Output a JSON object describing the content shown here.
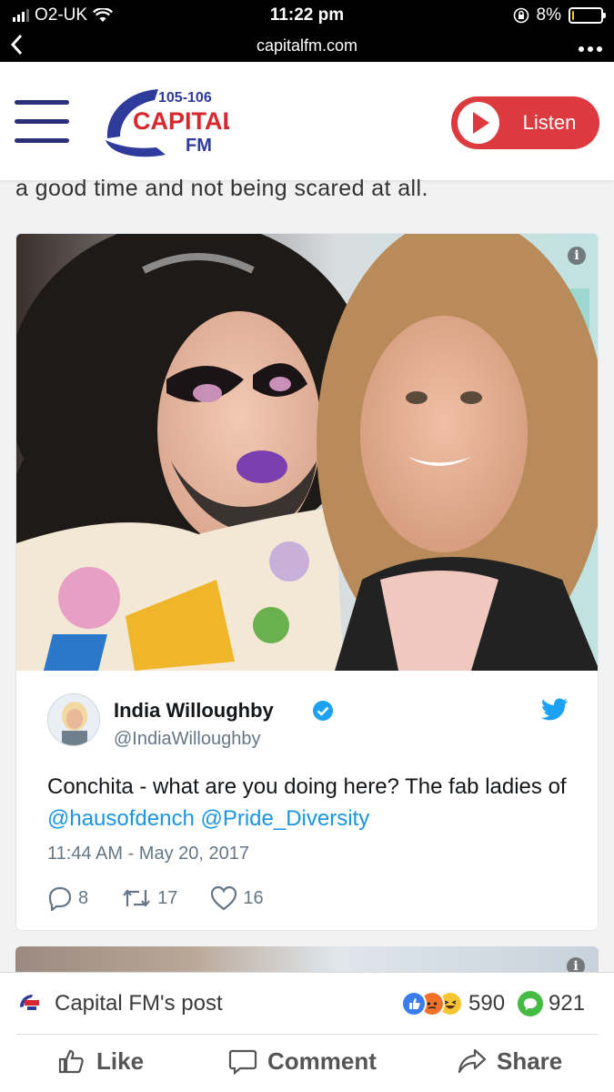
{
  "status_bar": {
    "carrier": "O2-UK",
    "time": "11:22 pm",
    "battery": "8%",
    "battery_level": 0.08
  },
  "browser": {
    "url": "capitalfm.com",
    "back_icon": "chevron-left-icon",
    "more_icon": "more-icon"
  },
  "header": {
    "logo_top": "105-106",
    "logo_main": "CAPITAL",
    "logo_sub": "FM",
    "listen_label": "Listen",
    "accent": "#dc3a3f",
    "menu_color": "#2a3178"
  },
  "article": {
    "text": "a good time and not being scared at all."
  },
  "tweet": {
    "name": "India Willoughby",
    "handle": "@IndiaWilloughby",
    "text_before": "Conchita - what are you doing here? The fab ladies of ",
    "mention1": "@hausofdench",
    "mention2": "@Pride_Diversity",
    "timestamp": "11:44 AM - May 20, 2017",
    "replies": "8",
    "retweets": "17",
    "likes": "16",
    "link_color": "#1b95e0"
  },
  "facebook": {
    "post_label": "Capital FM's post",
    "reactions_count": "590",
    "comments_count": "921",
    "like_label": "Like",
    "comment_label": "Comment",
    "share_label": "Share"
  }
}
